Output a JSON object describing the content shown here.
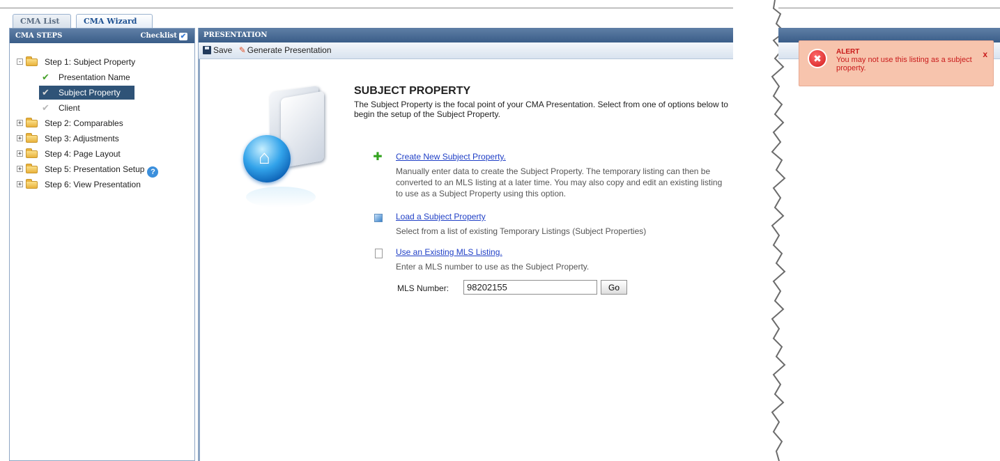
{
  "tabs": [
    {
      "label": "CMA List"
    },
    {
      "label": "CMA Wizard",
      "close": "X"
    }
  ],
  "left_panel": {
    "title": "CMA STEPS",
    "checklist_label": "Checklist",
    "steps": [
      {
        "label": "Step 1: Subject Property",
        "expander": "-",
        "expanded": true,
        "children": [
          {
            "label": "Presentation Name",
            "status": "complete"
          },
          {
            "label": "Subject Property",
            "status": "selected"
          },
          {
            "label": "Client",
            "status": "incomplete"
          }
        ]
      },
      {
        "label": "Step 2: Comparables",
        "expander": "+"
      },
      {
        "label": "Step 3: Adjustments",
        "expander": "+"
      },
      {
        "label": "Step 4: Page Layout",
        "expander": "+"
      },
      {
        "label": "Step 5: Presentation Setup",
        "expander": "+",
        "help": "?"
      },
      {
        "label": "Step 6: View Presentation",
        "expander": "+"
      }
    ]
  },
  "main": {
    "title": "PRESENTATION",
    "toolbar": {
      "save": "Save",
      "generate": "Generate Presentation"
    },
    "heading": "SUBJECT PROPERTY",
    "description": "The Subject Property is the focal point of your CMA Presentation. Select from one of options below to begin the setup of the Subject Property.",
    "options": [
      {
        "icon": "plus-icon",
        "link": "Create New Subject Property.",
        "desc": "Manually enter data to create the Subject Property. The temporary listing can then be converted to an MLS listing at a later time. You may also copy and edit an existing listing to use as a Subject Property using this option."
      },
      {
        "icon": "photo-icon",
        "link": "Load a Subject Property",
        "desc": "Select from a list of existing Temporary Listings (Subject Properties)"
      },
      {
        "icon": "page-icon",
        "link": "Use an Existing MLS Listing.",
        "desc": "Enter a MLS number to use as the Subject Property."
      }
    ],
    "mls": {
      "label": "MLS Number:",
      "value": "98202155",
      "go": "Go"
    }
  },
  "alert": {
    "title": "ALERT",
    "message": "You may not use this listing as a subject property.",
    "close": "x"
  },
  "colors": {
    "header_blue": "#3a5d88",
    "link_blue": "#1f3fc6",
    "alert_bg": "#f7c4ad",
    "alert_text": "#c91a1a",
    "selected_row": "#2f5377"
  }
}
